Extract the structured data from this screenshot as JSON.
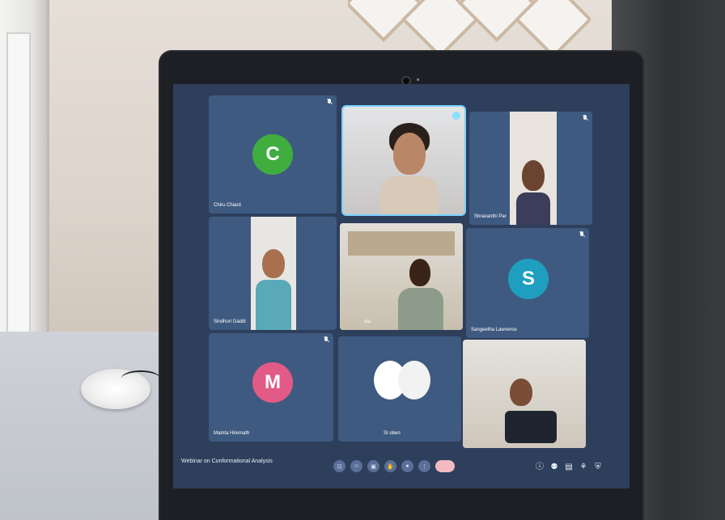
{
  "meeting": {
    "title": "Webinar on Conformational Analysis"
  },
  "tiles": [
    {
      "name": "Chiru Chiard",
      "initial": "C",
      "avatar_color": "#3fae3f",
      "muted": true
    },
    {
      "name": "",
      "initial": "",
      "video": true,
      "active": true
    },
    {
      "name": "Shravanthi Par",
      "initial": "",
      "video": true,
      "muted": true
    },
    {
      "name": "Sindhuri Gaddi",
      "initial": "",
      "video": true
    },
    {
      "name": "ula",
      "initial": "",
      "video": true
    },
    {
      "name": "Sangeetha Lawrence",
      "initial": "S",
      "avatar_color": "#1f9fc0",
      "muted": true
    },
    {
      "name": "Mamta Hiremath",
      "initial": "M",
      "avatar_color": "#e25b86",
      "muted": true
    },
    {
      "name": "SI oben",
      "initial": "",
      "avatar_color": "#ffffff"
    },
    {
      "name": "",
      "initial": "",
      "video": true
    }
  ],
  "controls": [
    {
      "icon": "captions-icon"
    },
    {
      "icon": "emoji-icon"
    },
    {
      "icon": "present-icon"
    },
    {
      "icon": "hand-icon"
    },
    {
      "icon": "mic-icon"
    },
    {
      "icon": "more-icon"
    },
    {
      "icon": "end-call-icon"
    }
  ],
  "right_icons": [
    {
      "icon": "info-icon"
    },
    {
      "icon": "people-icon"
    },
    {
      "icon": "chat-icon"
    },
    {
      "icon": "activities-icon"
    },
    {
      "icon": "shield-icon"
    }
  ]
}
